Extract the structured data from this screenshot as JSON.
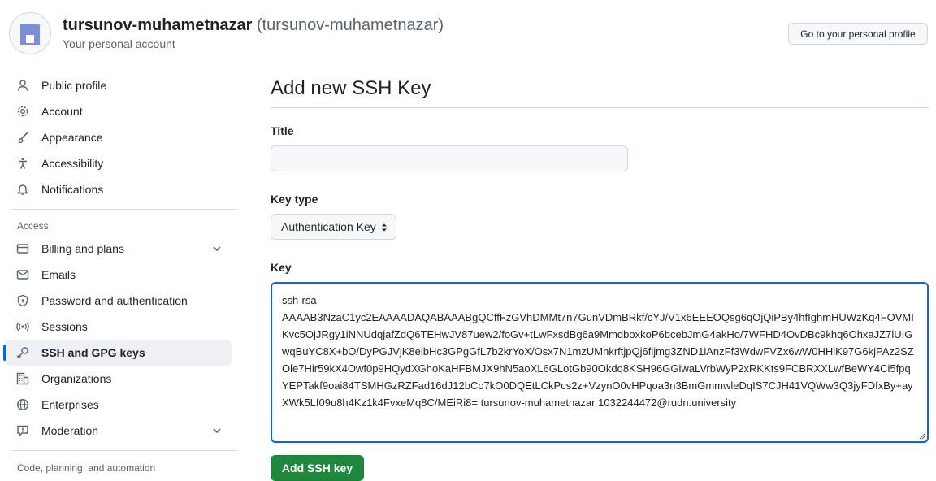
{
  "account": {
    "username": "tursunov-muhametnazar",
    "handle": "(tursunov-muhametnazar)",
    "subtitle": "Your personal account",
    "profile_button": "Go to your personal profile"
  },
  "sidebar": {
    "items": [
      {
        "label": "Public profile",
        "icon": "person-icon"
      },
      {
        "label": "Account",
        "icon": "gear-icon"
      },
      {
        "label": "Appearance",
        "icon": "paintbrush-icon"
      },
      {
        "label": "Accessibility",
        "icon": "accessibility-icon"
      },
      {
        "label": "Notifications",
        "icon": "bell-icon"
      }
    ],
    "access_label": "Access",
    "access_items": [
      {
        "label": "Billing and plans",
        "icon": "credit-card-icon",
        "expandable": true
      },
      {
        "label": "Emails",
        "icon": "mail-icon"
      },
      {
        "label": "Password and authentication",
        "icon": "shield-lock-icon"
      },
      {
        "label": "Sessions",
        "icon": "broadcast-icon"
      },
      {
        "label": "SSH and GPG keys",
        "icon": "key-icon",
        "active": true
      },
      {
        "label": "Organizations",
        "icon": "organization-icon"
      },
      {
        "label": "Enterprises",
        "icon": "globe-icon"
      },
      {
        "label": "Moderation",
        "icon": "report-icon",
        "expandable": true
      }
    ],
    "code_label": "Code, planning, and automation"
  },
  "main": {
    "title": "Add new SSH Key",
    "title_field_label": "Title",
    "title_value": "",
    "key_type_label": "Key type",
    "key_type_value": "Authentication Key",
    "key_label": "Key",
    "key_value": "ssh-rsa\nAAAAB3NzaC1yc2EAAAADAQABAAABgQCffFzGVhDMMt7n7GunVDmBRkf/cYJ/V1x6EEEOQsg6qOjQiPBy4hfIghmHUWzKq4FOVMIKvc5OjJRgy1iNNUdqjafZdQ6TEHwJV87uew2/foGv+tLwFxsdBg6a9MmdboxkoP6bcebJmG4akHo/7WFHD4OvDBc9khq6OhxaJZ7lUIGwqBuYC8X+bO/DyPGJVjK8eibHc3GPgGfL7b2krYoX/Osx7N1mzUMnkrftjpQj6fijmg3ZND1iAnzFf3WdwFVZx6wW0HHlK97G6kjPAz2SZOle7Hir59kX4Owf0p9HQydXGhoKaHFBMJX9hN5aoXL6GLotGb90Okdq8KSH96GGiwaLVrbWyP2xRKKts9FCBRXXLwfBeWY4Ci5fpqYEPTakf9oai84TSMHGzRZFad16dJ12bCo7kO0DQEtLCkPcs2z+VzynO0vHPqoa3n3BmGmmwleDqIS7CJH41VQWw3Q3jyFDfxBy+ayXWk5Lf09u8h4Kz1k4FvxeMq8C/MEiRi8= tursunov-muhametnazar 1032244472@rudn.university",
    "submit_label": "Add SSH key"
  },
  "colors": {
    "accent": "#0969da",
    "primary_button": "#1f883d"
  }
}
